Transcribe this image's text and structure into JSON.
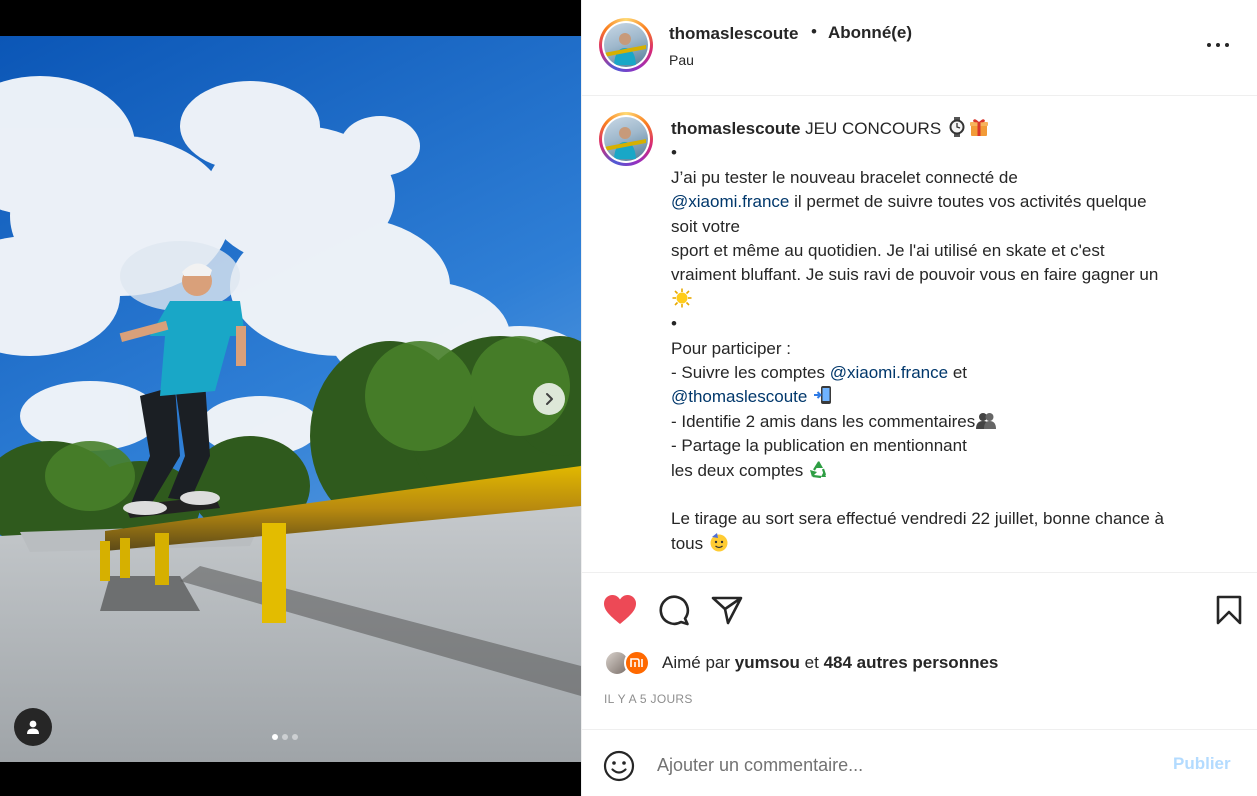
{
  "post": {
    "author": "thomaslescoute",
    "separator": "•",
    "follow_status": "Abonné(e)",
    "location": "Pau",
    "carousel": {
      "slide_count": 3,
      "active_index": 0
    }
  },
  "caption": {
    "username": "thomaslescoute",
    "title": " JEU CONCOURS ",
    "lines": [
      "•",
      "J’ai pu tester le nouveau bracelet connecté de",
      "il permet de suivre toutes vos activités quelque",
      "soit votre",
      "sport et même au quotidien. Je l'ai utilisé en skate et c'est",
      "vraiment bluffant. Je suis ravi de pouvoir vous en faire gagner un",
      "•",
      "Pour participer :",
      "- Suivre les comptes",
      "et",
      "- Identifie 2 amis dans les commentaires",
      "- Partage la publication en mentionnant",
      "les deux comptes",
      "Le tirage au sort sera effectué vendredi 22 juillet, bonne chance à",
      "tous"
    ],
    "mentions": [
      "@xiaomi.france",
      "@xiaomi.france",
      "@thomaslescoute"
    ]
  },
  "engagement": {
    "liked_prefix": "Aimé par ",
    "liked_user": "yumsou",
    "liked_mid": " et ",
    "others": "484 autres personnes",
    "timestamp": "IL Y A 5 JOURS"
  },
  "comment_box": {
    "placeholder": "Ajouter un commentaire...",
    "publish_label": "Publier"
  },
  "icons": {
    "like": "heart-filled-icon",
    "comment": "comment-icon",
    "share": "paper-plane-icon",
    "save": "bookmark-icon",
    "emoji": "smiley-icon",
    "more": "more-horizontal-icon",
    "next": "chevron-right-icon",
    "tags": "user-tag-icon"
  },
  "colors": {
    "like_red": "#ed4956",
    "mention_blue": "#00376b",
    "publish_disabled": "#b3dbff",
    "meta_gray": "#8e8e8e"
  }
}
